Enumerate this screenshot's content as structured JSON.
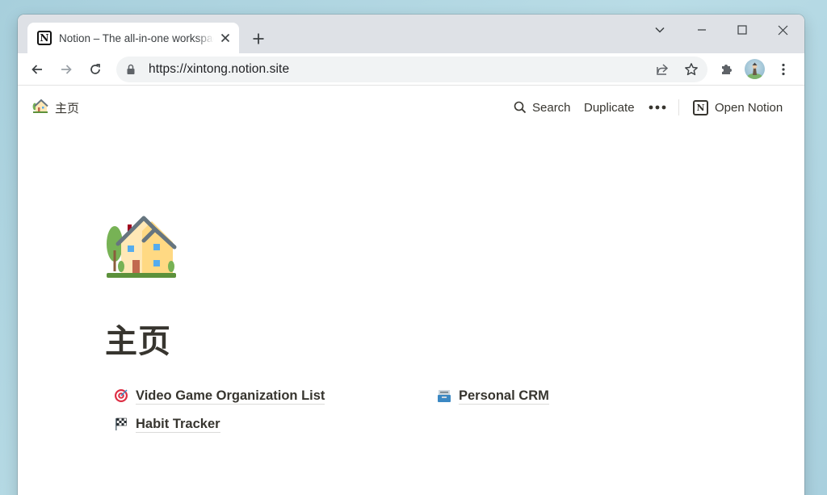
{
  "browser": {
    "tab": {
      "title": "Notion – The all-in-one workspace",
      "favicon": "N"
    },
    "url": "https://xintong.notion.site",
    "colors": {
      "tabstrip": "#dee1e6",
      "omnibox": "#f1f3f4"
    }
  },
  "topbar": {
    "breadcrumb": "主页",
    "search": "Search",
    "duplicate": "Duplicate",
    "open_notion": "Open Notion"
  },
  "page": {
    "icon": "house-emoji-icon",
    "title": "主页",
    "links": [
      {
        "label": "Video Game Organization List",
        "icon": "target-icon"
      },
      {
        "label": "Personal CRM",
        "icon": "card-index-icon"
      },
      {
        "label": "Habit Tracker",
        "icon": "checkered-flag-icon"
      }
    ],
    "text_color": "#37352f"
  }
}
